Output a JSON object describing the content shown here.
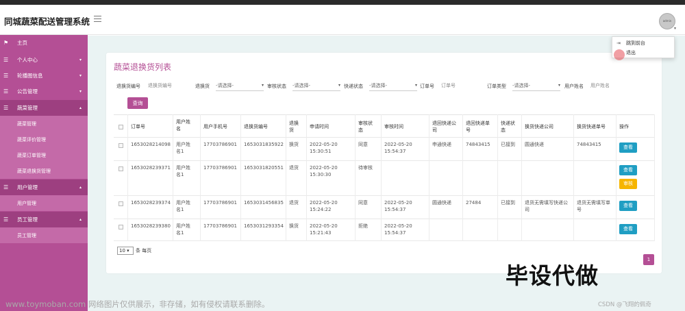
{
  "app": {
    "title": "同城蔬菜配送管理系统"
  },
  "user_menu": {
    "items": [
      {
        "label": "跳到前台",
        "icon": "sign-in-icon"
      },
      {
        "label": "退出",
        "icon": "logout-icon"
      }
    ]
  },
  "sidebar": {
    "items": [
      {
        "label": "主页",
        "icon": "flag-icon",
        "has_arrow": false
      },
      {
        "label": "个人中心",
        "icon": "list-icon",
        "has_arrow": true
      },
      {
        "label": "轮播图信息",
        "icon": "list-icon",
        "has_arrow": true
      },
      {
        "label": "公告管理",
        "icon": "list-icon",
        "has_arrow": true
      },
      {
        "label": "蔬菜管理",
        "icon": "list-icon",
        "has_arrow": true,
        "expanded": true
      },
      {
        "label": "用户管理",
        "icon": "list-icon",
        "has_arrow": true,
        "expanded": true
      },
      {
        "label": "员工管理",
        "icon": "list-icon",
        "has_arrow": true,
        "expanded": true
      }
    ],
    "sub_veg": [
      "蔬菜管理",
      "蔬菜评价管理",
      "蔬菜订单管理",
      "蔬菜退换货管理"
    ],
    "sub_user": [
      "用户管理"
    ],
    "sub_staff": [
      "员工管理"
    ]
  },
  "page": {
    "title": "蔬菜退换货列表"
  },
  "filters": {
    "return_no_label": "退换货编号",
    "return_no_placeholder": "退换货编号",
    "type_label": "退换货",
    "type_value": "-请选择-",
    "audit_label": "审核状态",
    "audit_value": "-请选择-",
    "express_label": "快递状态",
    "express_value": "-请选择-",
    "order_label": "订单号",
    "order_placeholder": "订单号",
    "order_type_label": "订单类型",
    "order_type_value": "-请选择-",
    "username_label": "用户姓名",
    "username_placeholder": "用户姓名",
    "query_button": "查询"
  },
  "table": {
    "headers": [
      "订单号",
      "用户姓名",
      "用户手机号",
      "退换货编号",
      "退换货",
      "申请时间",
      "审核状态",
      "审核时间",
      "退回快递公司",
      "退回快递单号",
      "快递状态",
      "换货快递公司",
      "换货快递单号",
      "操作"
    ],
    "rows": [
      {
        "order": "1653028214098",
        "name": "用户姓名1",
        "phone": "17703786901",
        "return_no": "1653031835922",
        "type": "换货",
        "apply_time": "2022-05-20 15:30:51",
        "audit": "同意",
        "audit_time": "2022-05-20 15:54:37",
        "ret_company": "申通快递",
        "ret_no": "74843415",
        "express": "已接到",
        "ex_company": "圆通快递",
        "ex_no": "74843415",
        "actions": [
          "查看"
        ]
      },
      {
        "order": "1653028239371",
        "name": "用户姓名1",
        "phone": "17703786901",
        "return_no": "1653031820551",
        "type": "退货",
        "apply_time": "2022-05-20 15:30:30",
        "audit": "待审核",
        "audit_time": "",
        "ret_company": "",
        "ret_no": "",
        "express": "",
        "ex_company": "",
        "ex_no": "",
        "actions": [
          "查看",
          "审核"
        ]
      },
      {
        "order": "1653028239374",
        "name": "用户姓名1",
        "phone": "17703786901",
        "return_no": "1653031456835",
        "type": "退货",
        "apply_time": "2022-05-20 15:24:22",
        "audit": "同意",
        "audit_time": "2022-05-20 15:54:37",
        "ret_company": "圆通快递",
        "ret_no": "27484",
        "express": "已接到",
        "ex_company": "退货无需填写快递公司",
        "ex_no": "退货无需填写单号",
        "actions": [
          "查看"
        ]
      },
      {
        "order": "1653028239380",
        "name": "用户姓名1",
        "phone": "17703786901",
        "return_no": "1653031293354",
        "type": "换货",
        "apply_time": "2022-05-20 15:21:43",
        "audit": "拒绝",
        "audit_time": "2022-05-20 15:54:37",
        "ret_company": "",
        "ret_no": "",
        "express": "",
        "ex_company": "",
        "ex_no": "",
        "actions": [
          "查看"
        ]
      }
    ]
  },
  "pager": {
    "page_size": "10 ▾",
    "per_page_label": "条 每页",
    "current_page": "1"
  },
  "overlay_text": "毕设代做",
  "watermarks": {
    "left": "www.toymoban.com 网络图片仅供展示，非存储，如有侵权请联系删除。",
    "right": "CSDN @飞翔的佩奇"
  },
  "colors": {
    "sidebar": "#b44f95",
    "accent": "#b44f95",
    "view_button": "#1f9ec3",
    "audit_button": "#f6b500"
  }
}
